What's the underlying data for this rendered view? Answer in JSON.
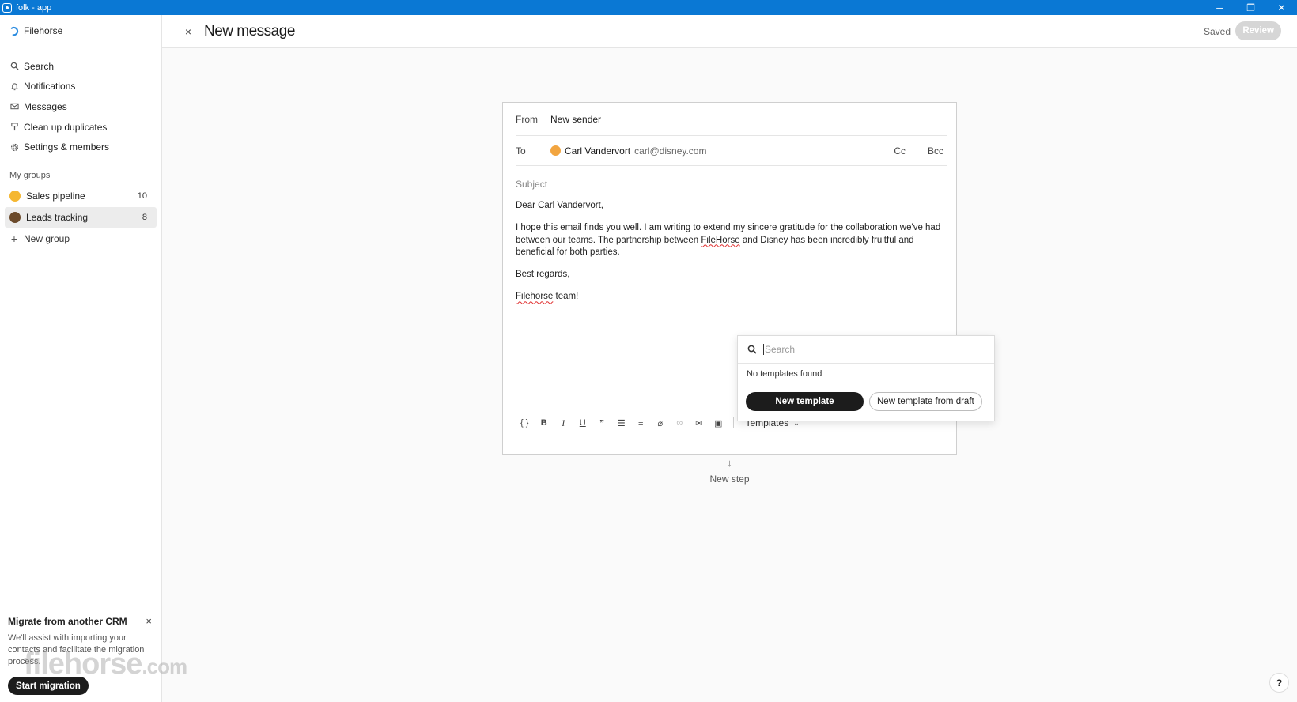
{
  "window": {
    "title": "folk - app",
    "minimize": "─",
    "restore": "❐",
    "close": "✕"
  },
  "sidebar": {
    "workspace": "Filehorse",
    "nav": [
      {
        "label": "Search",
        "icon": "search-icon"
      },
      {
        "label": "Notifications",
        "icon": "bell-icon"
      },
      {
        "label": "Messages",
        "icon": "mail-icon"
      },
      {
        "label": "Clean up duplicates",
        "icon": "broom-icon"
      },
      {
        "label": "Settings & members",
        "icon": "gear-icon"
      }
    ],
    "groups_title": "My groups",
    "groups": [
      {
        "label": "Sales pipeline",
        "count": "10",
        "emoji_color": "#f5b731",
        "active": false
      },
      {
        "label": "Leads tracking",
        "count": "8",
        "emoji_color": "#6b4a2b",
        "active": true
      }
    ],
    "new_group": "New group",
    "migrate": {
      "title": "Migrate from another CRM",
      "text": "We'll assist with importing your contacts and facilitate the migration process.",
      "button": "Start migration",
      "close": "×"
    },
    "watermark": "filehorse",
    "watermark_suffix": ".com"
  },
  "header": {
    "close": "×",
    "title": "New message",
    "status": "Saved",
    "review": "Review"
  },
  "email": {
    "from_label": "From",
    "from_value": "New sender",
    "to_label": "To",
    "recipient_name": "Carl Vandervort",
    "recipient_email": "carl@disney.com",
    "cc": "Cc",
    "bcc": "Bcc",
    "subject_placeholder": "Subject",
    "greeting": "Dear Carl Vandervort,",
    "para_before": "I hope this email finds you well. I am writing to extend my sincere gratitude for the collaboration we've had between our teams. The partnership between ",
    "para_brand": "FileHorse",
    "para_after": " and Disney has been incredibly fruitful and beneficial for both parties.",
    "closing": "Best regards,",
    "sign_brand": "Filehorse",
    "sign_after": " team!"
  },
  "toolbar": {
    "items": [
      {
        "name": "variable-button",
        "glyph": "{ }"
      },
      {
        "name": "bold-button",
        "glyph": "B"
      },
      {
        "name": "italic-button",
        "glyph": "I"
      },
      {
        "name": "underline-button",
        "glyph": "U"
      },
      {
        "name": "quote-button",
        "glyph": "❞"
      },
      {
        "name": "bullet-list-button",
        "glyph": "☰"
      },
      {
        "name": "numbered-list-button",
        "glyph": "≡"
      },
      {
        "name": "attachment-button",
        "glyph": "⌀"
      },
      {
        "name": "link-button",
        "glyph": "∞"
      },
      {
        "name": "email-settings-button",
        "glyph": "✉"
      },
      {
        "name": "image-button",
        "glyph": "▣"
      }
    ],
    "templates": "Templates"
  },
  "new_step": {
    "arrow": "↓",
    "label": "New step"
  },
  "templates_popover": {
    "search_placeholder": "Search",
    "empty": "No templates found",
    "new_template": "New template",
    "new_from_draft": "New template from draft"
  },
  "help": "?",
  "colors": {
    "titlebar": "#0a78d4",
    "primary_button": "#1c1c1c",
    "review_disabled": "#d6d6d6"
  }
}
